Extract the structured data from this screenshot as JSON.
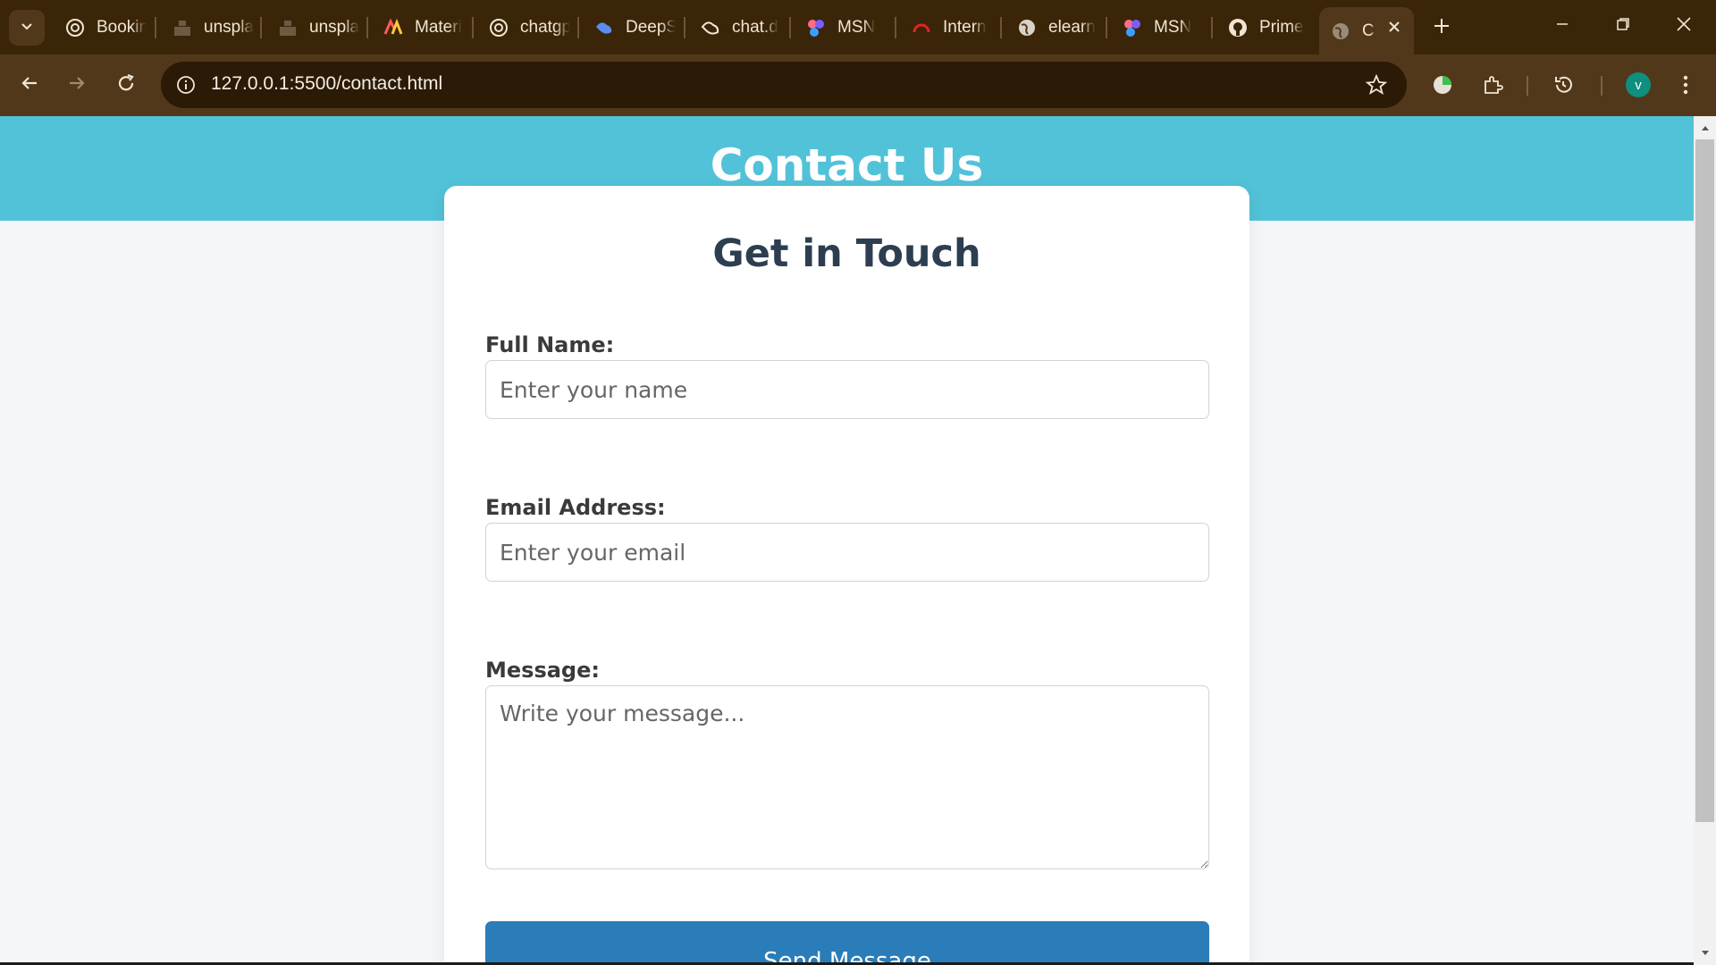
{
  "browser": {
    "tabs": [
      {
        "label": "Bookin",
        "icon": "openai-icon"
      },
      {
        "label": "unspla",
        "icon": "unsplash-icon"
      },
      {
        "label": "unspla",
        "icon": "unsplash-icon"
      },
      {
        "label": "Materi",
        "icon": "material-icon"
      },
      {
        "label": "chatgp",
        "icon": "openai-icon"
      },
      {
        "label": "DeepS",
        "icon": "deepseek-icon"
      },
      {
        "label": "chat.d",
        "icon": "deepseek-icon"
      },
      {
        "label": "MSN",
        "icon": "msn-icon"
      },
      {
        "label": "Intern",
        "icon": "speedometer-icon"
      },
      {
        "label": "elearn",
        "icon": "globe-icon"
      },
      {
        "label": "MSN",
        "icon": "msn-icon"
      },
      {
        "label": "Prime",
        "icon": "github-icon"
      }
    ],
    "active_tab": {
      "label": "C",
      "icon": "globe-icon"
    },
    "url": "127.0.0.1:5500/contact.html",
    "profile_initial": "v",
    "colors": {
      "frame": "#3a2508",
      "toolbar": "#52381a",
      "omnibox": "#2b1a05"
    }
  },
  "page": {
    "header_title": "Contact Us",
    "card_title": "Get in Touch",
    "fields": {
      "name_label": "Full Name:",
      "name_placeholder": "Enter your name",
      "email_label": "Email Address:",
      "email_placeholder": "Enter your email",
      "message_label": "Message:",
      "message_placeholder": "Write your message..."
    },
    "submit_label": "Send Message",
    "colors": {
      "header": "#52c2d8",
      "heading_text": "#2c3e50",
      "button": "#2a7db8",
      "background": "#f4f7f9"
    }
  }
}
